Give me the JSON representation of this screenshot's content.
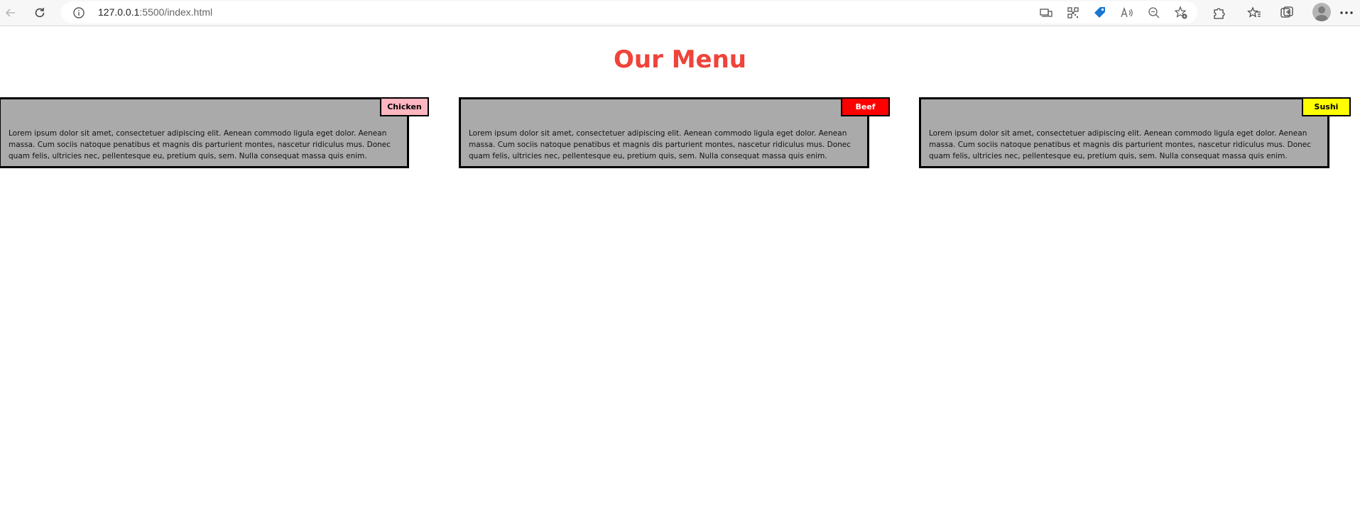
{
  "browser": {
    "url_host": "127.0.0.1",
    "url_rest": ":5500/index.html",
    "icons": {
      "back": "back-arrow-icon",
      "reload": "reload-icon",
      "site_info": "info-icon",
      "app_available": "app-available-icon",
      "qr": "qr-code-icon",
      "shopping": "shopping-tag-icon",
      "read_aloud": "read-aloud-icon",
      "zoom": "zoom-out-icon",
      "favorite": "add-favorite-icon",
      "extensions": "extensions-icon",
      "favorites": "favorites-icon",
      "collections": "collections-icon",
      "profile": "profile-avatar-icon",
      "more": "more-options-icon"
    }
  },
  "page": {
    "title": "Our Menu",
    "title_color": "#f0433a",
    "cards": [
      {
        "tag": "Chicken",
        "tag_color": "#ffb6c1",
        "tag_text_color": "#000000",
        "text": "Lorem ipsum dolor sit amet, consectetuer adipiscing elit. Aenean commodo ligula eget dolor. Aenean massa. Cum sociis natoque penatibus et magnis dis parturient montes, nascetur ridiculus mus. Donec quam felis, ultricies nec, pellentesque eu, pretium quis, sem. Nulla consequat massa quis enim."
      },
      {
        "tag": "Beef",
        "tag_color": "#ff0000",
        "tag_text_color": "#ffffff",
        "text": "Lorem ipsum dolor sit amet, consectetuer adipiscing elit. Aenean commodo ligula eget dolor. Aenean massa. Cum sociis natoque penatibus et magnis dis parturient montes, nascetur ridiculus mus. Donec quam felis, ultricies nec, pellentesque eu, pretium quis, sem. Nulla consequat massa quis enim."
      },
      {
        "tag": "Sushi",
        "tag_color": "#ffff00",
        "tag_text_color": "#000000",
        "text": "Lorem ipsum dolor sit amet, consectetuer adipiscing elit. Aenean commodo ligula eget dolor. Aenean massa. Cum sociis natoque penatibus et magnis dis parturient montes, nascetur ridiculus mus. Donec quam felis, ultricies nec, pellentesque eu, pretium quis, sem. Nulla consequat massa quis enim."
      }
    ]
  }
}
